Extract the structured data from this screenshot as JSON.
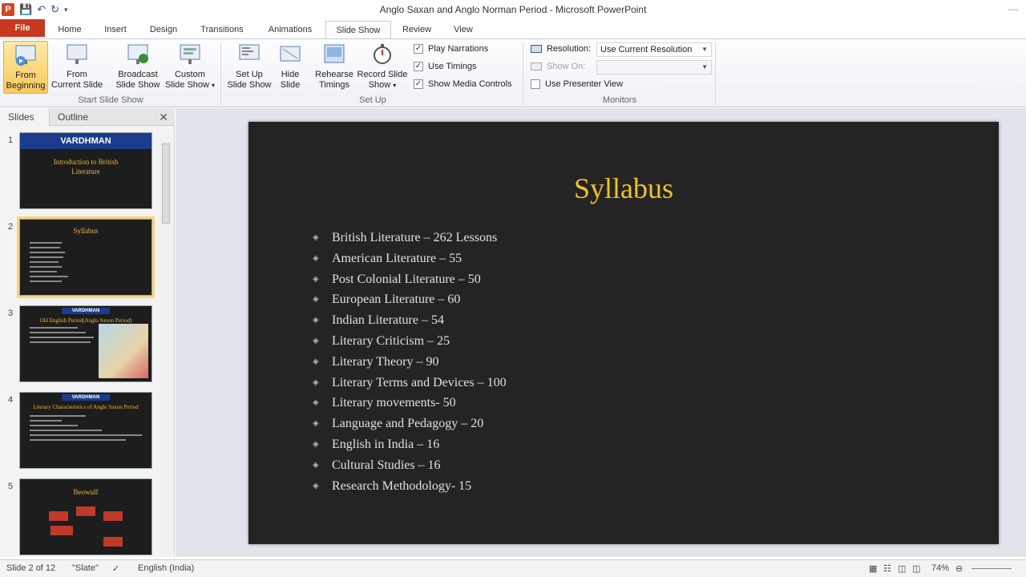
{
  "window": {
    "title": "Anglo Saxan and Anglo Norman Period  -  Microsoft PowerPoint",
    "app_icon": "P",
    "min": "—"
  },
  "tabs": {
    "file": "File",
    "items": [
      "Home",
      "Insert",
      "Design",
      "Transitions",
      "Animations",
      "Slide Show",
      "Review",
      "View"
    ],
    "active": "Slide Show"
  },
  "ribbon": {
    "buttons": [
      {
        "label1": "From",
        "label2": "Beginning"
      },
      {
        "label1": "From",
        "label2": "Current Slide"
      },
      {
        "label1": "Broadcast",
        "label2": "Slide Show"
      },
      {
        "label1": "Custom",
        "label2": "Slide Show"
      },
      {
        "label1": "Set Up",
        "label2": "Slide Show"
      },
      {
        "label1": "Hide",
        "label2": "Slide"
      },
      {
        "label1": "Rehearse",
        "label2": "Timings"
      },
      {
        "label1": "Record Slide",
        "label2": "Show"
      }
    ],
    "groups": {
      "start": "Start Slide Show",
      "setup": "Set Up",
      "monitors": "Monitors"
    },
    "checks": {
      "play_narrations": "Play Narrations",
      "use_timings": "Use Timings",
      "show_media_controls": "Show Media Controls",
      "use_presenter_view": "Use Presenter View"
    },
    "resolution_label": "Resolution:",
    "resolution_value": "Use Current Resolution",
    "show_on_label": "Show On:"
  },
  "left_panel": {
    "tabs": [
      "Slides",
      "Outline"
    ],
    "thumbs": [
      {
        "num": "1",
        "banner": "VARDHMAN",
        "title": "Introduction to British Literature"
      },
      {
        "num": "2",
        "banner": "",
        "title": "Syllabus"
      },
      {
        "num": "3",
        "banner": "VARDHMAN",
        "title": "Old English Period(Anglo Saxon Period)"
      },
      {
        "num": "4",
        "banner": "VARDHMAN",
        "title": "Literary Characteristics of Anglo Saxon Period"
      },
      {
        "num": "5",
        "banner": "",
        "title": "Beowulf"
      }
    ]
  },
  "slide": {
    "title": "Syllabus",
    "bullets": [
      "British Literature – 262 Lessons",
      "American Literature – 55",
      "Post Colonial Literature – 50",
      "European Literature – 60",
      "Indian Literature – 54",
      "Literary Criticism – 25",
      "Literary Theory – 90",
      "Literary Terms and Devices – 100",
      "Literary movements- 50",
      "Language and Pedagogy  – 20",
      "English in India – 16",
      "Cultural Studies – 16",
      "Research Methodology- 15"
    ]
  },
  "status": {
    "slide": "Slide 2 of 12",
    "theme": "\"Slate\"",
    "language": "English (India)",
    "zoom": "74%"
  }
}
